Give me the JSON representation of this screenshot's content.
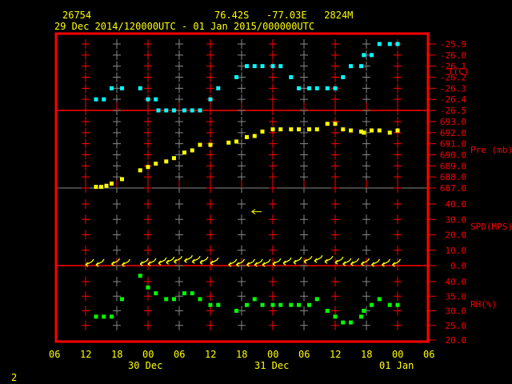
{
  "header": {
    "station": "26754",
    "location": "76.42S   -77.03E   2824M",
    "period": "29 Dec 2014/120000UTC - 01 Jan 2015/000000UTC",
    "page": "2"
  },
  "chart_data": [
    {
      "type": "scatter",
      "name": "temperature",
      "ylabel": "T(C)",
      "ylim": [
        -26.5,
        -25.9
      ],
      "ticks": [
        "-25.9",
        "-26.0",
        "-26.1",
        "-26.2",
        "-26.3",
        "-26.4",
        "-26.5"
      ],
      "color": "#00ffff",
      "x_hours": [
        2,
        3.5,
        5,
        7,
        10.5,
        12,
        13.5,
        14,
        15.5,
        17,
        19,
        20.5,
        22,
        24,
        25.5,
        29,
        31,
        32.5,
        34,
        36,
        37.5,
        39.5,
        41,
        43,
        44.5,
        46.5,
        48,
        49.5,
        51,
        53,
        53.5,
        55,
        56.5,
        58.5,
        60
      ],
      "values": [
        -26.4,
        -26.4,
        -26.3,
        -26.3,
        -26.3,
        -26.4,
        -26.4,
        -26.5,
        -26.5,
        -26.5,
        -26.5,
        -26.5,
        -26.5,
        -26.4,
        -26.3,
        -26.2,
        -26.1,
        -26.1,
        -26.1,
        -26.1,
        -26.1,
        -26.2,
        -26.3,
        -26.3,
        -26.3,
        -26.3,
        -26.3,
        -26.2,
        -26.1,
        -26.1,
        -26.0,
        -26.0,
        -25.9,
        -25.9,
        -25.9
      ]
    },
    {
      "type": "scatter",
      "name": "pressure",
      "ylabel": "Pre (mb)",
      "ylim": [
        687,
        693
      ],
      "ticks": [
        "693.0",
        "692.0",
        "691.0",
        "690.0",
        "689.0",
        "688.0",
        "687.0"
      ],
      "color": "#ffff00",
      "x_hours": [
        2,
        3,
        4,
        5,
        7,
        10.5,
        12,
        13.5,
        15.5,
        17,
        19,
        20.5,
        22,
        24,
        27.5,
        29,
        31,
        32.5,
        34,
        36,
        37.5,
        39.5,
        41,
        43,
        44.5,
        46.5,
        48,
        49.5,
        51,
        53,
        53.5,
        55,
        56.5,
        58.5,
        60
      ],
      "values": [
        687.1,
        687.1,
        687.2,
        687.4,
        687.8,
        688.6,
        688.9,
        689.2,
        689.4,
        689.7,
        690.2,
        690.4,
        690.9,
        690.9,
        691.1,
        691.2,
        691.6,
        691.7,
        692.1,
        692.3,
        692.3,
        692.3,
        692.3,
        692.3,
        692.3,
        692.8,
        692.8,
        692.3,
        692.2,
        692.1,
        692.0,
        692.2,
        692.2,
        692.0,
        692.2
      ]
    },
    {
      "type": "vector",
      "name": "wind",
      "ylabel": "SPD(MPS)",
      "ylim": [
        0,
        40
      ],
      "ticks": [
        "40.0",
        "30.0",
        "20.0",
        "10.0",
        "0.0"
      ],
      "color": "#ffff00",
      "x_hours": [
        0,
        2,
        5,
        7,
        10.5,
        12,
        14,
        15.5,
        17,
        19,
        20.5,
        22,
        24,
        27.5,
        29,
        31,
        32.5,
        34,
        36,
        38,
        40,
        42,
        44,
        46,
        48,
        49.5,
        51,
        53,
        55,
        57,
        59
      ],
      "values": [
        0.5,
        0.5,
        1,
        0.5,
        1,
        1,
        1.5,
        2,
        2.5,
        3,
        2.5,
        2,
        1.5,
        0.5,
        0.5,
        0.5,
        0.5,
        0.5,
        1,
        1.5,
        2,
        2.5,
        3,
        2.5,
        2,
        1,
        1,
        1,
        0.5,
        0.5,
        0.5
      ],
      "outlier": {
        "x_hours": 32,
        "value": 35
      }
    },
    {
      "type": "scatter",
      "name": "humidity",
      "ylabel": "RH(%)",
      "ylim": [
        20,
        40
      ],
      "ticks": [
        "40.0",
        "35.0",
        "30.0",
        "25.0",
        "20.0"
      ],
      "color": "#00ff00",
      "x_hours": [
        2,
        3.5,
        5,
        7,
        10.5,
        12,
        13.5,
        15.5,
        17,
        19,
        20.5,
        22,
        24,
        25.5,
        29,
        31,
        32.5,
        34,
        36,
        37.5,
        39.5,
        41,
        43,
        44.5,
        46.5,
        48,
        49.5,
        51,
        53,
        53.5,
        55,
        56.5,
        58.5,
        60
      ],
      "values": [
        28,
        28,
        28,
        34,
        42,
        38,
        36,
        34,
        34,
        36,
        36,
        34,
        32,
        32,
        30,
        32,
        34,
        32,
        32,
        32,
        32,
        32,
        32,
        34,
        30,
        28,
        26,
        26,
        28,
        30,
        32,
        34,
        32,
        32
      ]
    }
  ],
  "x_axis": {
    "ticks": [
      "06",
      "12",
      "18",
      "00",
      "06",
      "12",
      "18",
      "00",
      "06",
      "12",
      "18",
      "00",
      "06"
    ],
    "dates": [
      "30 Dec",
      "31 Dec",
      "01 Jan"
    ]
  }
}
